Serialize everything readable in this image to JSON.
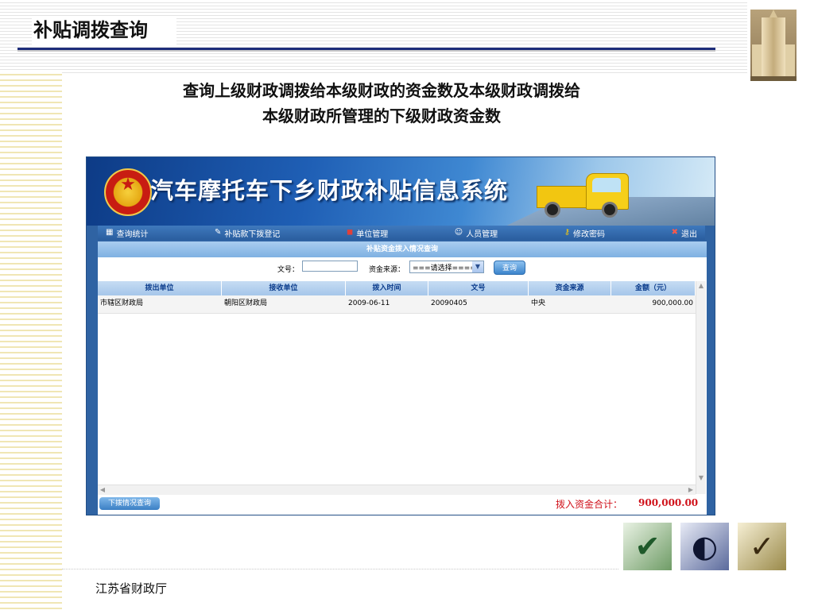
{
  "slide": {
    "title": "补贴调拨查询",
    "description_line1": "查询上级财政调拨给本级财政的资金数及本级财政调拨给",
    "description_line2": "本级财政所管理的下级财政资金数",
    "footer": "江苏省财政厅"
  },
  "app": {
    "title": "汽车摩托车下乡财政补贴信息系统",
    "nav": [
      {
        "label": "查询统计",
        "icon": "chart-icon"
      },
      {
        "label": "补贴款下拨登记",
        "icon": "pencil-icon"
      },
      {
        "label": "单位管理",
        "icon": "unit-icon"
      },
      {
        "label": "人员管理",
        "icon": "user-icon"
      },
      {
        "label": "修改密码",
        "icon": "key-icon"
      },
      {
        "label": "退出",
        "icon": "close-icon"
      }
    ],
    "section_title": "补贴资金拨入情况查询",
    "search": {
      "doc_no_label": "文号：",
      "doc_no_value": "",
      "source_label": "资金来源：",
      "source_selected": "===请选择====",
      "query_button": "查询"
    },
    "table": {
      "columns": [
        "拨出单位",
        "接收单位",
        "拨入时间",
        "文号",
        "资金来源",
        "金额（元）"
      ],
      "rows": [
        [
          "市辖区财政局",
          "朝阳区财政局",
          "2009-06-11",
          "20090405",
          "中央",
          "900,000.00"
        ]
      ]
    },
    "footer": {
      "sub_button": "下拨情况查询",
      "total_label": "拨入资金合计：",
      "total_value": "900,000.00"
    }
  }
}
